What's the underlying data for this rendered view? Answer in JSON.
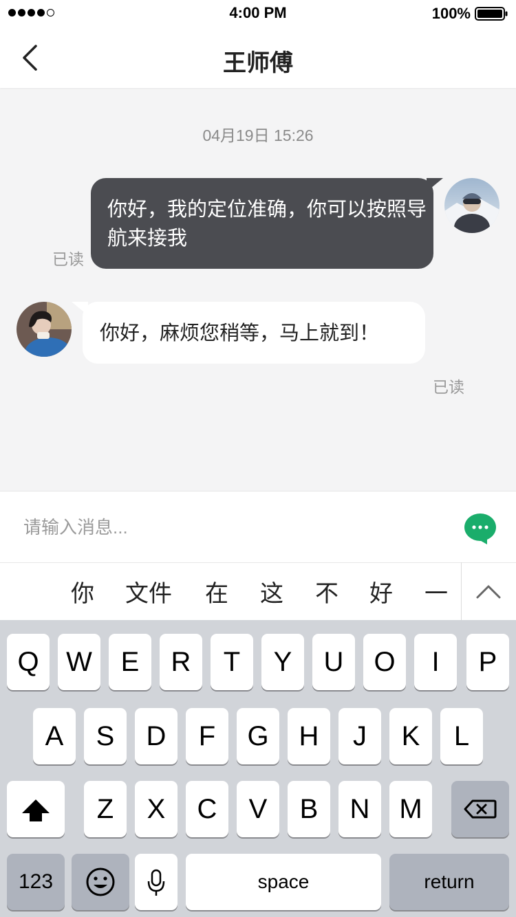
{
  "status_bar": {
    "time": "4:00 PM",
    "battery": "100%",
    "signal_dots_filled": 4,
    "signal_dots_total": 5
  },
  "nav": {
    "title": "王师傅",
    "back_icon": "chevron-left-icon"
  },
  "chat": {
    "timestamp": "04月19日 15:26",
    "messages": [
      {
        "sender": "me",
        "text": "你好，我的定位准确，你可以按照导航来接我",
        "status": "已读"
      },
      {
        "sender": "driver",
        "text": "你好，麻烦您稍等，马上就到！",
        "status": "已读"
      }
    ],
    "outgoing_bubble_color": "#4b4c51",
    "incoming_bubble_color": "#ffffff"
  },
  "composer": {
    "placeholder": "请输入消息...",
    "value": "",
    "action_icon": "chat-bubble-icon",
    "accent": "#1aad6b"
  },
  "ime": {
    "candidates": [
      "你",
      "文件",
      "在",
      "这",
      "不",
      "好",
      "一"
    ],
    "expand_icon": "chevron-up-icon"
  },
  "keyboard": {
    "row1": [
      "Q",
      "W",
      "E",
      "R",
      "T",
      "Y",
      "U",
      "O",
      "I",
      "P"
    ],
    "row2": [
      "A",
      "S",
      "D",
      "F",
      "G",
      "H",
      "J",
      "K",
      "L"
    ],
    "row3": [
      "Z",
      "X",
      "C",
      "V",
      "B",
      "N",
      "M"
    ],
    "shift_icon": "shift-arrow-icon",
    "delete_icon": "backspace-icon",
    "numbers_label": "123",
    "emoji_icon": "emoji-icon",
    "mic_icon": "microphone-icon",
    "space_label": "space",
    "return_label": "return"
  }
}
